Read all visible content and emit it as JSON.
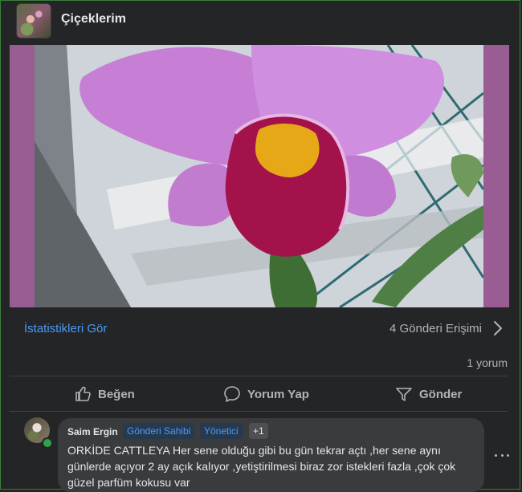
{
  "header": {
    "title": "Çiçeklerim"
  },
  "post": {
    "stats_link": "İstatistikleri Gör",
    "reach": "4 Gönderi Erişimi",
    "comment_count": "1 yorum"
  },
  "actions": {
    "like": "Beğen",
    "comment": "Yorum Yap",
    "share": "Gönder"
  },
  "comment": {
    "author": "Saim Ergin",
    "badges": [
      "Gönderi Sahibi",
      "Yönetici",
      "+1"
    ],
    "text": "ORKİDE CATTLEYA Her sene olduğu gibi bu gün tekrar açtı ,her sene aynı günlerde açıyor 2 ay açık kalıyor ,yetiştirilmesi biraz zor istekleri fazla ,çok çok güzel parfüm kokusu var"
  },
  "colors": {
    "background": "#242526",
    "link": "#4b9bf5",
    "photo_border": "#9a5d93",
    "online": "#31a24c"
  },
  "icons": {
    "chevron": "chevron-right-icon",
    "like": "thumbs-up-icon",
    "comment": "speech-bubble-icon",
    "share": "share-arrow-icon",
    "more": "more-horizontal-icon"
  }
}
